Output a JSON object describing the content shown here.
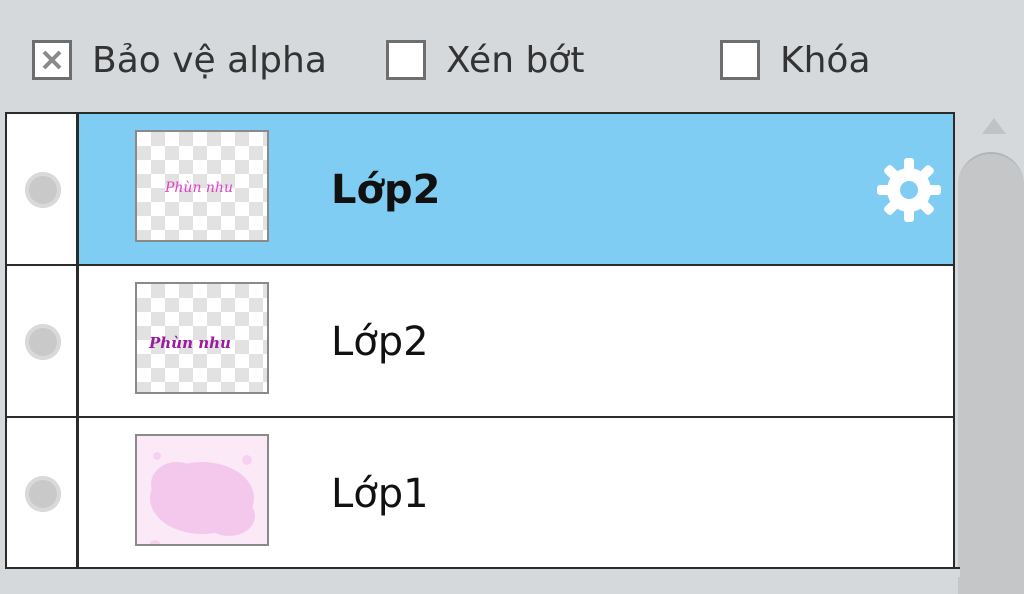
{
  "options": {
    "alpha_protect": {
      "label": "Bảo vệ alpha",
      "checked": true
    },
    "clipping": {
      "label": "Xén bớt",
      "checked": false
    },
    "lock": {
      "label": "Khóa",
      "checked": false
    }
  },
  "layers": [
    {
      "name": "Lớp2",
      "selected": true,
      "thumbnail": "magenta-text-on-transparent",
      "thumb_text": "Phùn nhu"
    },
    {
      "name": "Lớp2",
      "selected": false,
      "thumbnail": "purple-text-on-transparent",
      "thumb_text": "Phùn nhu"
    },
    {
      "name": "Lớp1",
      "selected": false,
      "thumbnail": "pink-cloud-fill",
      "thumb_text": ""
    }
  ],
  "icons": {
    "visibility": "visibility-dot-icon",
    "settings": "gear-icon",
    "scroll_up": "scroll-up-arrow-icon"
  },
  "colors": {
    "selected_row": "#80cdf4",
    "thumb_text_magenta": "#e040c8",
    "thumb_text_purple": "#9a1aa0",
    "thumb_pink": "#f3c8ec"
  }
}
